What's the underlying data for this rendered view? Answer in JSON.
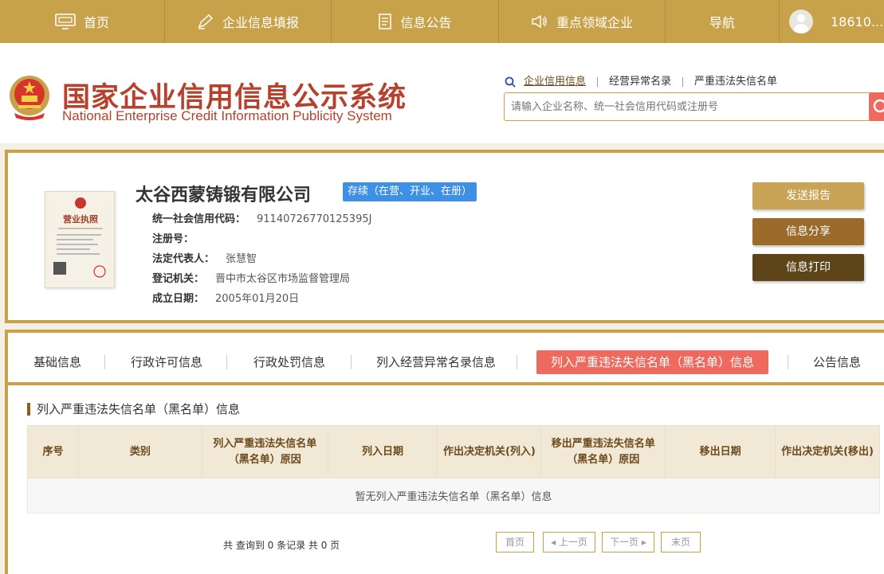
{
  "nav": {
    "home": "首页",
    "enterprise_fill": "企业信息填报",
    "announcement": "信息公告",
    "key_enterprise": "重点领域企业",
    "navigation": "导航",
    "user": "18610..."
  },
  "header": {
    "title_cn": "国家企业信用信息公示系统",
    "title_en": "National Enterprise Credit Information Publicity System",
    "search_tabs": [
      "企业信用信息",
      "经营异常名录",
      "严重违法失信名单"
    ],
    "search_placeholder": "请输入企业名称、统一社会信用代码或注册号"
  },
  "company": {
    "name": "太谷西蒙铸锻有限公司",
    "status": "存续（在营、开业、在册）",
    "fields": [
      {
        "label": "统一社会信用代码：",
        "value": "91140726770125395J"
      },
      {
        "label": "注册号：",
        "value": ""
      },
      {
        "label": "法定代表人：",
        "value": "张慧智"
      },
      {
        "label": "登记机关：",
        "value": "晋中市太谷区市场监督管理局"
      },
      {
        "label": "成立日期：",
        "value": "2005年01月20日"
      }
    ],
    "buttons": {
      "send": "发送报告",
      "share": "信息分享",
      "print": "信息打印"
    },
    "license_title": "营业执照"
  },
  "tabs": [
    "基础信息",
    "行政许可信息",
    "行政处罚信息",
    "列入经营异常名录信息",
    "列入严重违法失信名单（黑名单）信息",
    "公告信息"
  ],
  "active_tab_index": 4,
  "section": {
    "title": "列入严重违法失信名单（黑名单）信息",
    "columns": [
      "序号",
      "类别",
      "列入严重违法失信名单（黑名单）原因",
      "列入日期",
      "作出决定机关(列入)",
      "移出严重违法失信名单（黑名单）原因",
      "移出日期",
      "作出决定机关(移出)"
    ],
    "empty_message": "暂无列入严重违法失信名单（黑名单）信息",
    "records_text": "共 查询到 0 条记录 共 0 页",
    "pager": {
      "first": "首页",
      "prev": "上一页",
      "next": "下一页",
      "last": "末页"
    }
  },
  "colors": {
    "gold": "#c8a24a",
    "red_title": "#b6412d",
    "active_tab": "#ee6a5e",
    "badge_blue": "#3e8fe6"
  }
}
